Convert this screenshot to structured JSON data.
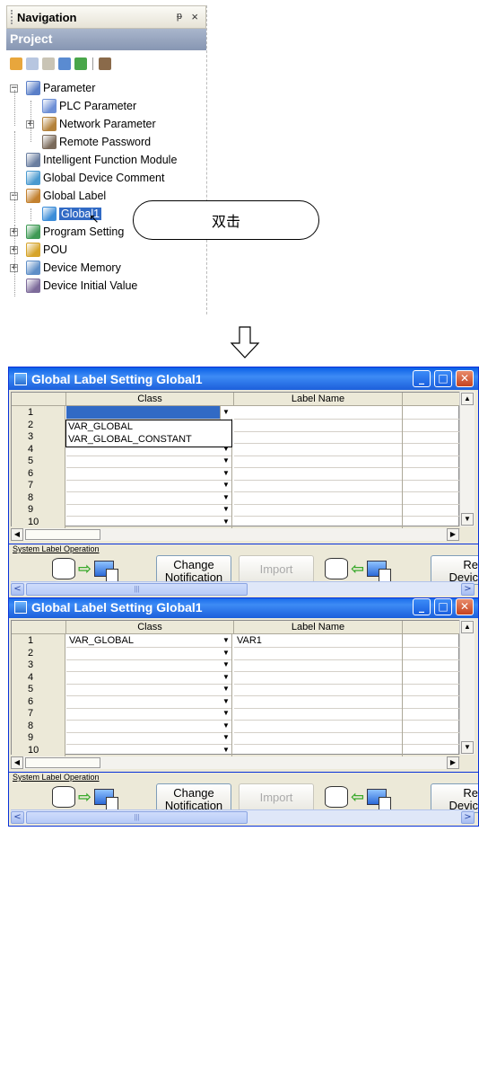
{
  "navigation": {
    "title": "Navigation",
    "pin_glyph": "ᵽ",
    "close_glyph": "×",
    "project_label": "Project",
    "toolbar_icons": [
      "new-icon",
      "copy-icon",
      "paste-icon",
      "properties-icon",
      "refresh-icon",
      "search-icon"
    ],
    "tree": [
      {
        "label": "Parameter",
        "level": 0,
        "expander": "−",
        "icon": "parameter-folder-icon"
      },
      {
        "label": "PLC Parameter",
        "level": 1,
        "expander": "",
        "icon": "plc-parameter-icon"
      },
      {
        "label": "Network Parameter",
        "level": 1,
        "expander": "+",
        "icon": "network-parameter-icon"
      },
      {
        "label": "Remote Password",
        "level": 1,
        "expander": "",
        "icon": "remote-password-icon"
      },
      {
        "label": "Intelligent Function Module",
        "level": 0,
        "expander": "",
        "icon": "intelligent-module-icon"
      },
      {
        "label": "Global Device Comment",
        "level": 0,
        "expander": "",
        "icon": "device-comment-icon"
      },
      {
        "label": "Global Label",
        "level": 0,
        "expander": "−",
        "icon": "global-label-folder-icon"
      },
      {
        "label": "Global1",
        "level": 1,
        "expander": "",
        "icon": "global-label-icon",
        "selected": true
      },
      {
        "label": "Program Setting",
        "level": 0,
        "expander": "+",
        "icon": "program-setting-icon"
      },
      {
        "label": "POU",
        "level": 0,
        "expander": "+",
        "icon": "pou-icon"
      },
      {
        "label": "Device Memory",
        "level": 0,
        "expander": "+",
        "icon": "device-memory-icon"
      },
      {
        "label": "Device Initial Value",
        "level": 0,
        "expander": "",
        "icon": "device-initial-value-icon"
      }
    ]
  },
  "callout": {
    "text": "双击"
  },
  "arrow_glyph": "⇩",
  "window1": {
    "title": "Global Label Setting Global1",
    "columns": {
      "class": "Class",
      "label_name": "Label Name"
    },
    "rows": [
      {
        "n": "1",
        "class": "",
        "label": ""
      },
      {
        "n": "2",
        "class": "",
        "label": ""
      },
      {
        "n": "3",
        "class": "",
        "label": ""
      },
      {
        "n": "4",
        "class": "",
        "label": ""
      },
      {
        "n": "5",
        "class": "",
        "label": ""
      },
      {
        "n": "6",
        "class": "",
        "label": ""
      },
      {
        "n": "7",
        "class": "",
        "label": ""
      },
      {
        "n": "8",
        "class": "",
        "label": ""
      },
      {
        "n": "9",
        "class": "",
        "label": ""
      },
      {
        "n": "10",
        "class": "",
        "label": ""
      }
    ],
    "dropdown_options": [
      "VAR_GLOBAL",
      "VAR_GLOBAL_CONSTANT"
    ],
    "system_label_operation": "System Label Operation",
    "change_notification": [
      "Change",
      "Notification"
    ],
    "import": "Import",
    "re_device": [
      "Re",
      "Devic"
    ]
  },
  "window2": {
    "title": "Global Label Setting Global1",
    "columns": {
      "class": "Class",
      "label_name": "Label Name"
    },
    "rows": [
      {
        "n": "1",
        "class": "VAR_GLOBAL",
        "label": "VAR1"
      },
      {
        "n": "2",
        "class": "",
        "label": ""
      },
      {
        "n": "3",
        "class": "",
        "label": ""
      },
      {
        "n": "4",
        "class": "",
        "label": ""
      },
      {
        "n": "5",
        "class": "",
        "label": ""
      },
      {
        "n": "6",
        "class": "",
        "label": ""
      },
      {
        "n": "7",
        "class": "",
        "label": ""
      },
      {
        "n": "8",
        "class": "",
        "label": ""
      },
      {
        "n": "9",
        "class": "",
        "label": ""
      },
      {
        "n": "10",
        "class": "",
        "label": ""
      }
    ],
    "system_label_operation": "System Label Operation",
    "change_notification": [
      "Change",
      "Notification"
    ],
    "import": "Import",
    "re_device": [
      "Re",
      "Devic"
    ]
  },
  "colors": {
    "title_bar": "#1c5fdb",
    "selection": "#316ac5",
    "project_bar": "#8796b2"
  }
}
